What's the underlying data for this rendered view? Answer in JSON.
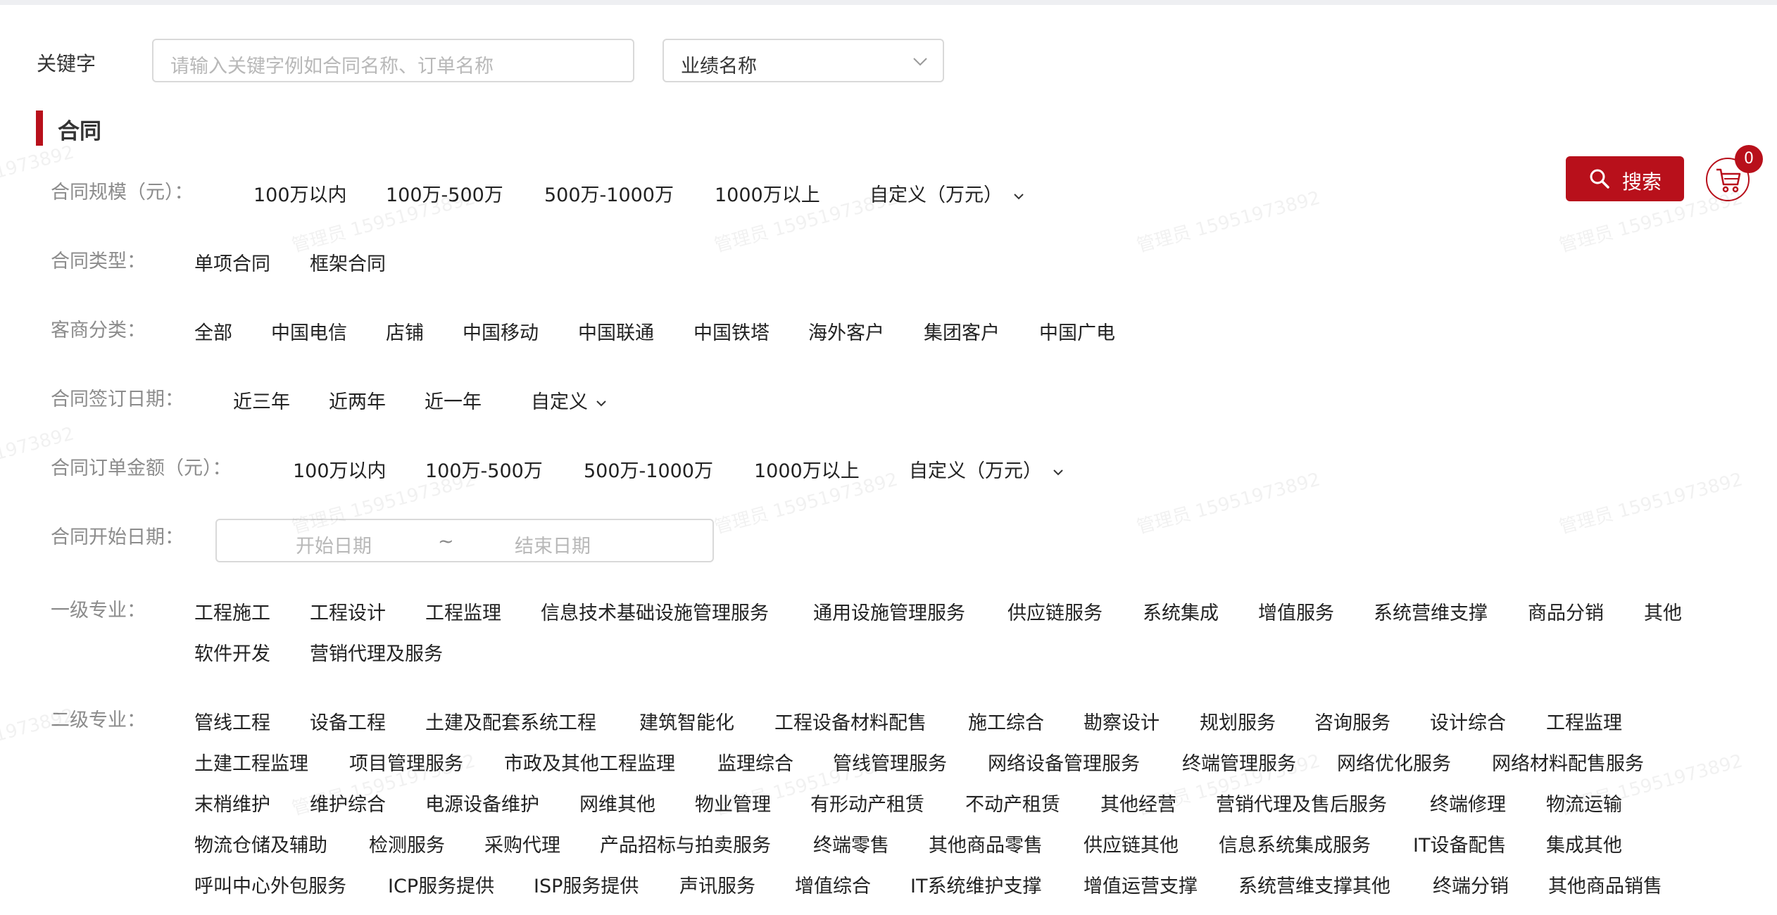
{
  "filters": {
    "keyword_label": "关键字",
    "keyword_placeholder": "请输入关键字例如合同名称、订单名称",
    "performance_select": "业绩名称"
  },
  "section_title": "合同",
  "rows": {
    "scale": {
      "label": "合同规模（元）：",
      "options": [
        "100万以内",
        "100万-500万",
        "500万-1000万",
        "1000万以上",
        "自定义（万元）"
      ]
    },
    "type": {
      "label": "合同类型：",
      "options": [
        "单项合同",
        "框架合同"
      ]
    },
    "customer": {
      "label": "客商分类：",
      "options": [
        "全部",
        "中国电信",
        "店铺",
        "中国移动",
        "中国联通",
        "中国铁塔",
        "海外客户",
        "集团客户",
        "中国广电"
      ]
    },
    "sign_date": {
      "label": "合同签订日期：",
      "options": [
        "近三年",
        "近两年",
        "近一年",
        "自定义"
      ]
    },
    "amount": {
      "label": "合同订单金额（元）：",
      "options": [
        "100万以内",
        "100万-500万",
        "500万-1000万",
        "1000万以上",
        "自定义（万元）"
      ]
    },
    "start_date": {
      "label": "合同开始日期：",
      "start_placeholder": "开始日期",
      "separator": "~",
      "end_placeholder": "结束日期"
    },
    "level1": {
      "label": "一级专业：",
      "line1": [
        "工程施工",
        "工程设计",
        "工程监理",
        "信息技术基础设施管理服务",
        "通用设施管理服务",
        "供应链服务",
        "系统集成",
        "增值服务",
        "系统营维支撑",
        "商品分销",
        "其他"
      ],
      "line2": [
        "软件开发",
        "营销代理及服务"
      ]
    },
    "level2": {
      "label": "二级专业：",
      "line1": [
        "管线工程",
        "设备工程",
        "土建及配套系统工程",
        "建筑智能化",
        "工程设备材料配售",
        "施工综合",
        "勘察设计",
        "规划服务",
        "咨询服务",
        "设计综合",
        "工程监理"
      ],
      "line2": [
        "土建工程监理",
        "项目管理服务",
        "市政及其他工程监理",
        "监理综合",
        "管线管理服务",
        "网络设备管理服务",
        "终端管理服务",
        "网络优化服务",
        "网络材料配售服务"
      ],
      "line3": [
        "末梢维护",
        "维护综合",
        "电源设备维护",
        "网维其他",
        "物业管理",
        "有形动产租赁",
        "不动产租赁",
        "其他经营",
        "营销代理及售后服务",
        "终端修理",
        "物流运输"
      ],
      "line4": [
        "物流仓储及辅助",
        "检测服务",
        "采购代理",
        "产品招标与拍卖服务",
        "终端零售",
        "其他商品零售",
        "供应链其他",
        "信息系统集成服务",
        "IT设备配售",
        "集成其他"
      ],
      "line5": [
        "呼叫中心外包服务",
        "ICP服务提供",
        "ISP服务提供",
        "声讯服务",
        "增值综合",
        "IT系统维护支撑",
        "增值运营支撑",
        "系统营维支撑其他",
        "终端分销",
        "其他商品销售"
      ]
    }
  },
  "actions": {
    "search_label": "搜索",
    "cart_count": "0"
  },
  "watermark": "管理员 15951973892",
  "colors": {
    "accent": "#b8101b",
    "label_gray": "#8c8c8c",
    "placeholder_gray": "#b8b8b8"
  }
}
